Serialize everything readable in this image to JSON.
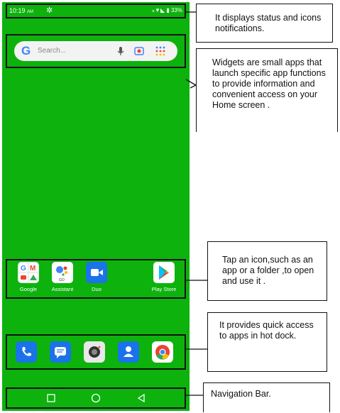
{
  "status_bar": {
    "time": "10:19",
    "ampm": "AM",
    "battery": "33%"
  },
  "search": {
    "placeholder": "Search..."
  },
  "home_apps": [
    {
      "label": "Google",
      "icon": "google-folder-icon"
    },
    {
      "label": "Assistant",
      "icon": "assistant-icon"
    },
    {
      "label": "Duo",
      "icon": "duo-icon"
    },
    {
      "label": "Play Store",
      "icon": "play-store-icon"
    }
  ],
  "assistant_badge": "GO",
  "dock_apps": [
    "phone-icon",
    "messages-icon",
    "camera-icon",
    "contacts-icon",
    "chrome-icon"
  ],
  "nav": [
    "recents-button",
    "home-button",
    "back-button"
  ],
  "callouts": {
    "status": "It displays status and icons notifications.",
    "widgets": "Widgets are small apps that launch specific app functions to provide information and convenient access on your Home screen .",
    "apps": "Tap an icon,such as an app or a folder ,to open and use it .",
    "dock": "It provides quick access to apps in hot dock.",
    "nav": "Navigation Bar."
  },
  "colors": {
    "screen": "#0db20d",
    "google_blue": "#4285f4"
  }
}
